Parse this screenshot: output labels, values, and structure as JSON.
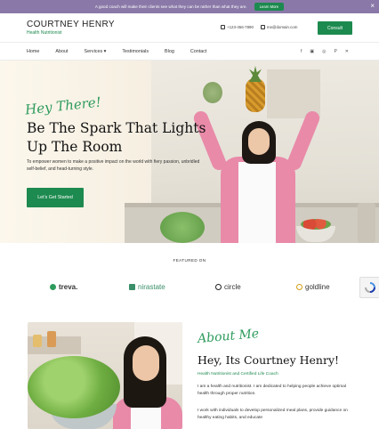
{
  "promo": {
    "text": "A good coach will make their clients see what they can be rather than what they are.",
    "button": "Learn More",
    "close": "×"
  },
  "header": {
    "brand": "COURTNEY HENRY",
    "tagline": "Health Nutritionist",
    "phone": "+123-456-7890",
    "email": "me@domain.com",
    "consult": "Consult"
  },
  "nav": {
    "items": [
      "Home",
      "About",
      "Services ▾",
      "Testimonials",
      "Blog",
      "Contact"
    ],
    "social": [
      "f",
      "▣",
      "◎",
      "P",
      "✕"
    ]
  },
  "hero": {
    "script": "Hey There!",
    "title": "Be The Spark That Lights Up The Room",
    "body": "To empower women to make a positive impact on the world with fiery passion, unbridled self-belief, and head-turning style.",
    "cta": "Let's Get Started"
  },
  "featured": {
    "label": "FEATURED ON",
    "logos": [
      "treva.",
      "nirastate",
      "circle",
      "goldline"
    ]
  },
  "about": {
    "script": "About Me",
    "title": "Hey, Its Courtney Henry!",
    "subtitle": "Health Nutritionist and Certified Life Coach",
    "p1": "I am a health and nutritionist. I am dedicated to helping people achieve optimal health through proper nutrition.",
    "p2": "I work with individuals to develop personalized meal plans, provide guidance on healthy eating habits, and educate"
  },
  "colors": {
    "accent": "#1d8a4f",
    "script": "#2e9b5d",
    "promo": "#8a79a8"
  }
}
